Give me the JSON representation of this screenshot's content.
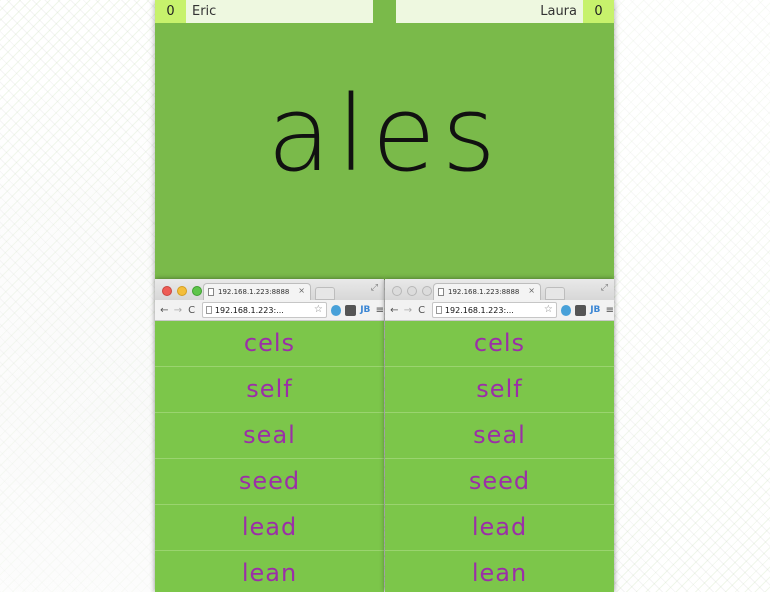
{
  "players": {
    "left": {
      "score": "0",
      "name": "Eric"
    },
    "right": {
      "score": "0",
      "name": "Laura"
    }
  },
  "current_word": "ales",
  "browser_left": {
    "tab_title": "192.168.1.223:8888",
    "url": "192.168.1.223:...",
    "words": [
      "cels",
      "self",
      "seal",
      "seed",
      "lead",
      "lean"
    ]
  },
  "browser_right": {
    "tab_title": "192.168.1.223:8888",
    "url": "192.168.1.223:...",
    "words": [
      "cels",
      "self",
      "seal",
      "seed",
      "lead",
      "lean"
    ]
  },
  "icons": {
    "close_tab": "×",
    "back": "←",
    "forward": "→",
    "reload": "C",
    "star": "☆",
    "menu": "≡",
    "expand": "⤢",
    "ext_jb": "JB"
  },
  "colors": {
    "board_green": "#7aba4a",
    "word_purple": "#9b2fa7",
    "score_green": "#c7f26c"
  }
}
